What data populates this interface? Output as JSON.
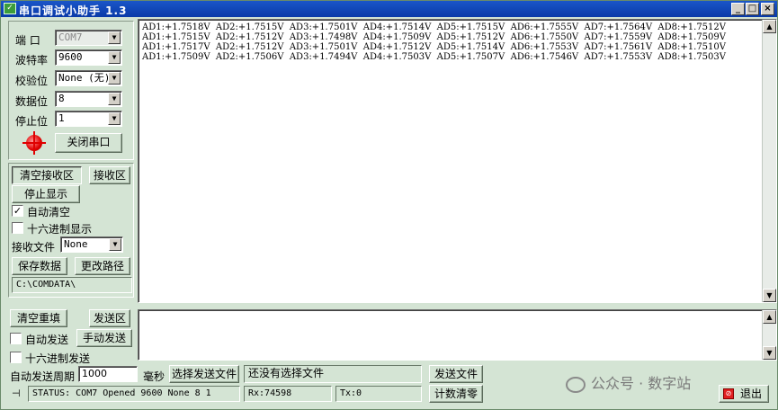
{
  "window": {
    "title": "串口调试小助手 1.3",
    "controls": {
      "minimize": "_",
      "maximize": "□",
      "close": "×"
    }
  },
  "port_settings": {
    "port_label": "端  口",
    "port_value": "COM7",
    "baud_label": "波特率",
    "baud_value": "9600",
    "parity_label": "校验位",
    "parity_value": "None (无)",
    "databits_label": "数据位",
    "databits_value": "8",
    "stopbits_label": "停止位",
    "stopbits_value": "1",
    "close_port_button": "关闭串口"
  },
  "receive_panel": {
    "clear_button": "清空接收区",
    "area_label": "接收区",
    "stop_display_button": "停止显示",
    "auto_clear_label": "自动清空",
    "auto_clear_checked": "✓",
    "hex_display_label": "十六进制显示",
    "file_label": "接收文件",
    "file_value": "None",
    "save_data_button": "保存数据",
    "change_path_button": "更改路径",
    "path_value": "C:\\COMDATA\\"
  },
  "receive_lines": [
    "AD1:+1.7518V  AD2:+1.7515V  AD3:+1.7501V  AD4:+1.7514V  AD5:+1.7515V  AD6:+1.7555V  AD7:+1.7564V  AD8:+1.7512V",
    "AD1:+1.7515V  AD2:+1.7512V  AD3:+1.7498V  AD4:+1.7509V  AD5:+1.7512V  AD6:+1.7550V  AD7:+1.7559V  AD8:+1.7509V",
    "AD1:+1.7517V  AD2:+1.7512V  AD3:+1.7501V  AD4:+1.7512V  AD5:+1.7514V  AD6:+1.7553V  AD7:+1.7561V  AD8:+1.7510V",
    "AD1:+1.7509V  AD2:+1.7506V  AD3:+1.7494V  AD4:+1.7503V  AD5:+1.7507V  AD6:+1.7546V  AD7:+1.7553V  AD8:+1.7503V"
  ],
  "send_panel": {
    "clear_button": "清空重填",
    "area_label": "发送区",
    "auto_send_label": "自动发送",
    "manual_send_button": "手动发送",
    "hex_send_label": "十六进制发送",
    "period_label": "自动发送周期",
    "period_value": "1000",
    "period_unit": "毫秒",
    "choose_file_button": "选择发送文件",
    "file_status": "还没有选择文件",
    "send_file_button": "发送文件",
    "reset_count_button": "计数清零",
    "exit_button": "退出"
  },
  "status": {
    "status_text": "STATUS: COM7 Opened 9600 None  8 1",
    "rx_text": "Rx:74598",
    "tx_text": "Tx:0"
  },
  "watermark": "公众号 · 数字站",
  "colors": {
    "window_bg": "#d4e4d4",
    "titlebar": "#0a3aa8",
    "led": "#e00000"
  }
}
